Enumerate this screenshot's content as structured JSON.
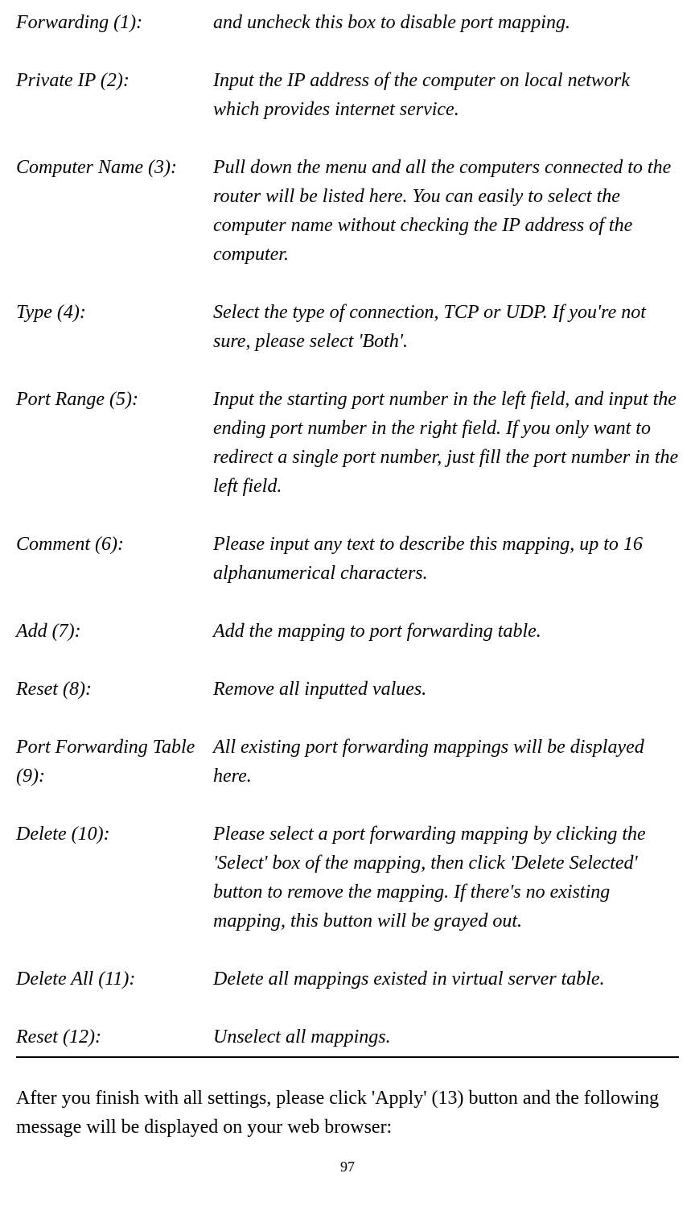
{
  "entries": [
    {
      "label": "Forwarding (1):",
      "desc": "and uncheck this box to disable port mapping."
    },
    {
      "label": "Private IP (2):",
      "desc": "Input the IP address of the computer on local network which provides internet service."
    },
    {
      "label": "Computer Name (3):",
      "desc": "Pull down the menu and all the computers connected to the router will be listed here. You can easily to select the computer name without checking the IP address of the computer."
    },
    {
      "label": "Type (4):",
      "desc": "Select the type of connection, TCP or UDP. If you're not sure, please select 'Both'."
    },
    {
      "label": "Port Range (5):",
      "desc": "Input the starting port number in the left field, and input the ending port number in the right field. If you only want to redirect a single port number, just fill the port number in the left field."
    },
    {
      "label": "Comment (6):",
      "desc": "Please input any text to describe this mapping, up to 16 alphanumerical characters."
    },
    {
      "label": "Add (7):",
      "desc": "Add the mapping to port forwarding table."
    },
    {
      "label": "Reset (8):",
      "desc": "Remove all inputted values."
    },
    {
      "label": "Port Forwarding Table (9):",
      "desc": "All existing port forwarding mappings will be displayed here."
    },
    {
      "label": "Delete (10):",
      "desc": "Please select a port forwarding mapping by clicking the 'Select' box of the mapping, then click 'Delete Selected' button to remove the mapping. If there's no existing mapping, this button will be grayed out."
    },
    {
      "label": "Delete All (11):",
      "desc": "Delete all mappings existed in virtual server table."
    },
    {
      "label": "Reset (12):",
      "desc": "Unselect all mappings."
    }
  ],
  "footer": "After you finish with all settings, please click 'Apply' (13) button and the following message will be displayed on your web browser:",
  "pageNumber": "97"
}
